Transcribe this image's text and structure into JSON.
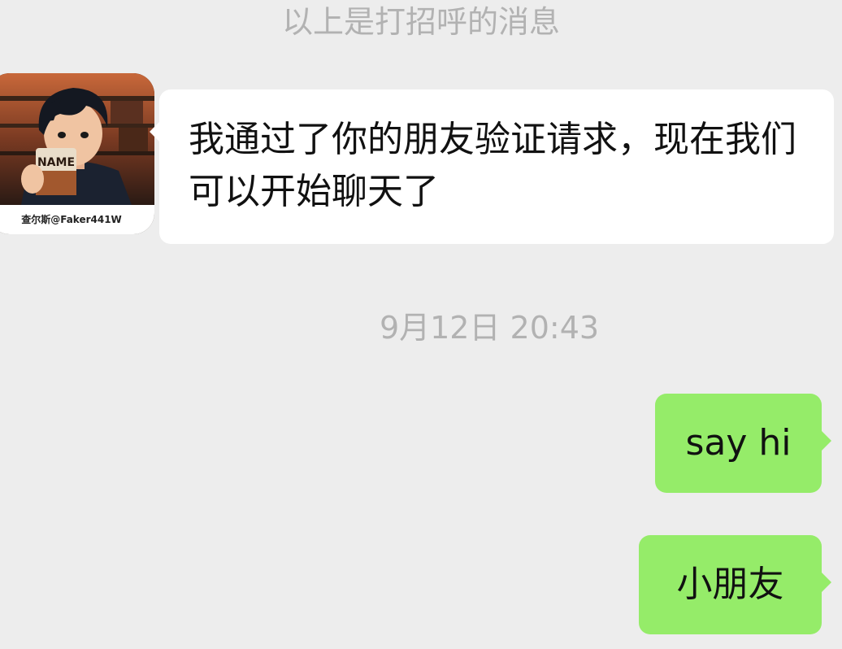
{
  "chat": {
    "system_note": "以上是打招呼的消息",
    "timestamp": "9月12日 20:43",
    "contact": {
      "avatar_caption": "查尔斯@Faker441W",
      "avatar_cup_text": "NAME"
    },
    "messages": [
      {
        "from": "contact",
        "text": "我通过了你的朋友验证请求，现在我们可以开始聊天了"
      },
      {
        "from": "me",
        "text": "say hi"
      },
      {
        "from": "me",
        "text": "小朋友"
      }
    ]
  },
  "colors": {
    "background": "#ededed",
    "incoming_bubble": "#ffffff",
    "outgoing_bubble": "#95ec69",
    "system_text": "#b2b2b2"
  }
}
